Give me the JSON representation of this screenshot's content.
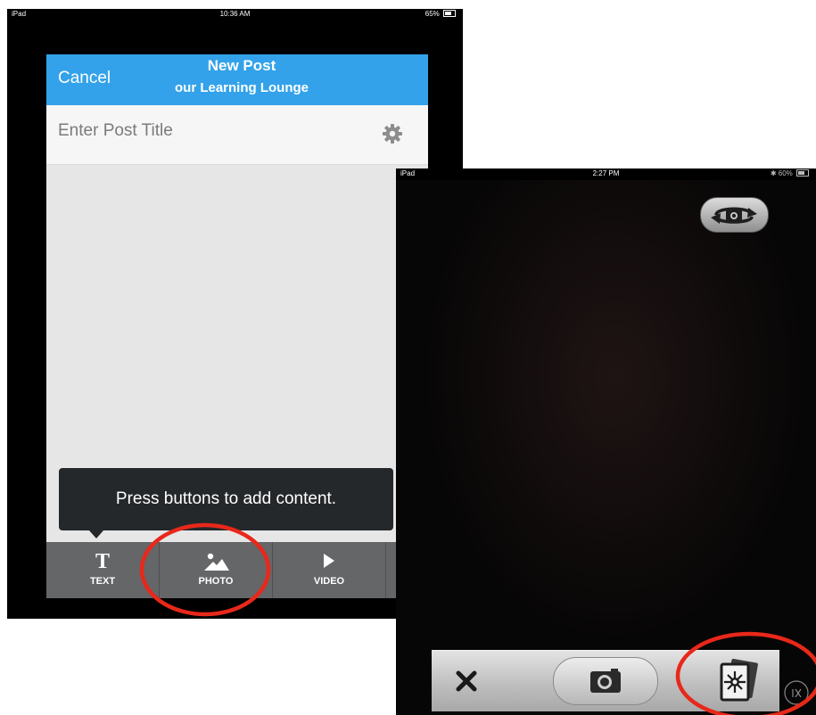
{
  "left_screen": {
    "status": {
      "carrier": "iPad",
      "time": "10:36 AM",
      "battery": "65%"
    },
    "nav": {
      "cancel_label": "Cancel",
      "title": "New Post",
      "subtitle": "our Learning Lounge"
    },
    "post_title": {
      "placeholder": "Enter Post Title",
      "value": "",
      "settings_icon": "gear-icon"
    },
    "tooltip_text": "Press buttons to add content.",
    "toolbar": [
      {
        "label": "TEXT",
        "icon": "text-icon"
      },
      {
        "label": "PHOTO",
        "icon": "photo-icon"
      },
      {
        "label": "VIDEO",
        "icon": "video-play-icon"
      }
    ],
    "colors": {
      "nav_bg": "#33a2ea",
      "toolbar_bg": "#646668",
      "tooltip_bg": "#25282b"
    }
  },
  "right_screen": {
    "status": {
      "carrier": "iPad",
      "time": "2:27 PM",
      "battery": "60%"
    },
    "controls": {
      "flip_camera_icon": "camera-flip-icon",
      "close_icon": "close-icon",
      "shutter_icon": "camera-icon",
      "photo_library_icon": "photo-library-icon"
    }
  },
  "annotations": {
    "highlight_color": "#e8281a"
  }
}
